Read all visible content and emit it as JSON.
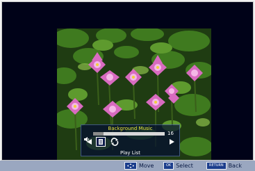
{
  "overlay": {
    "title": "Background Music",
    "volume": {
      "value": "16",
      "level_percent": 15
    },
    "label": "Play List",
    "controls": [
      "previous-arrow",
      "playlist-icon",
      "repeat-icon",
      "next-arrow"
    ]
  },
  "statusbar": {
    "move": {
      "key_icon": "dpad-icon",
      "label": "Move"
    },
    "select": {
      "key": "OK",
      "label": "Select"
    },
    "back": {
      "key": "RETURN",
      "label": "Back"
    }
  },
  "colors": {
    "background": "#000218",
    "title": "#e7e23a",
    "statusbar": "#9aa7c0",
    "key": "#1b3d8c"
  }
}
